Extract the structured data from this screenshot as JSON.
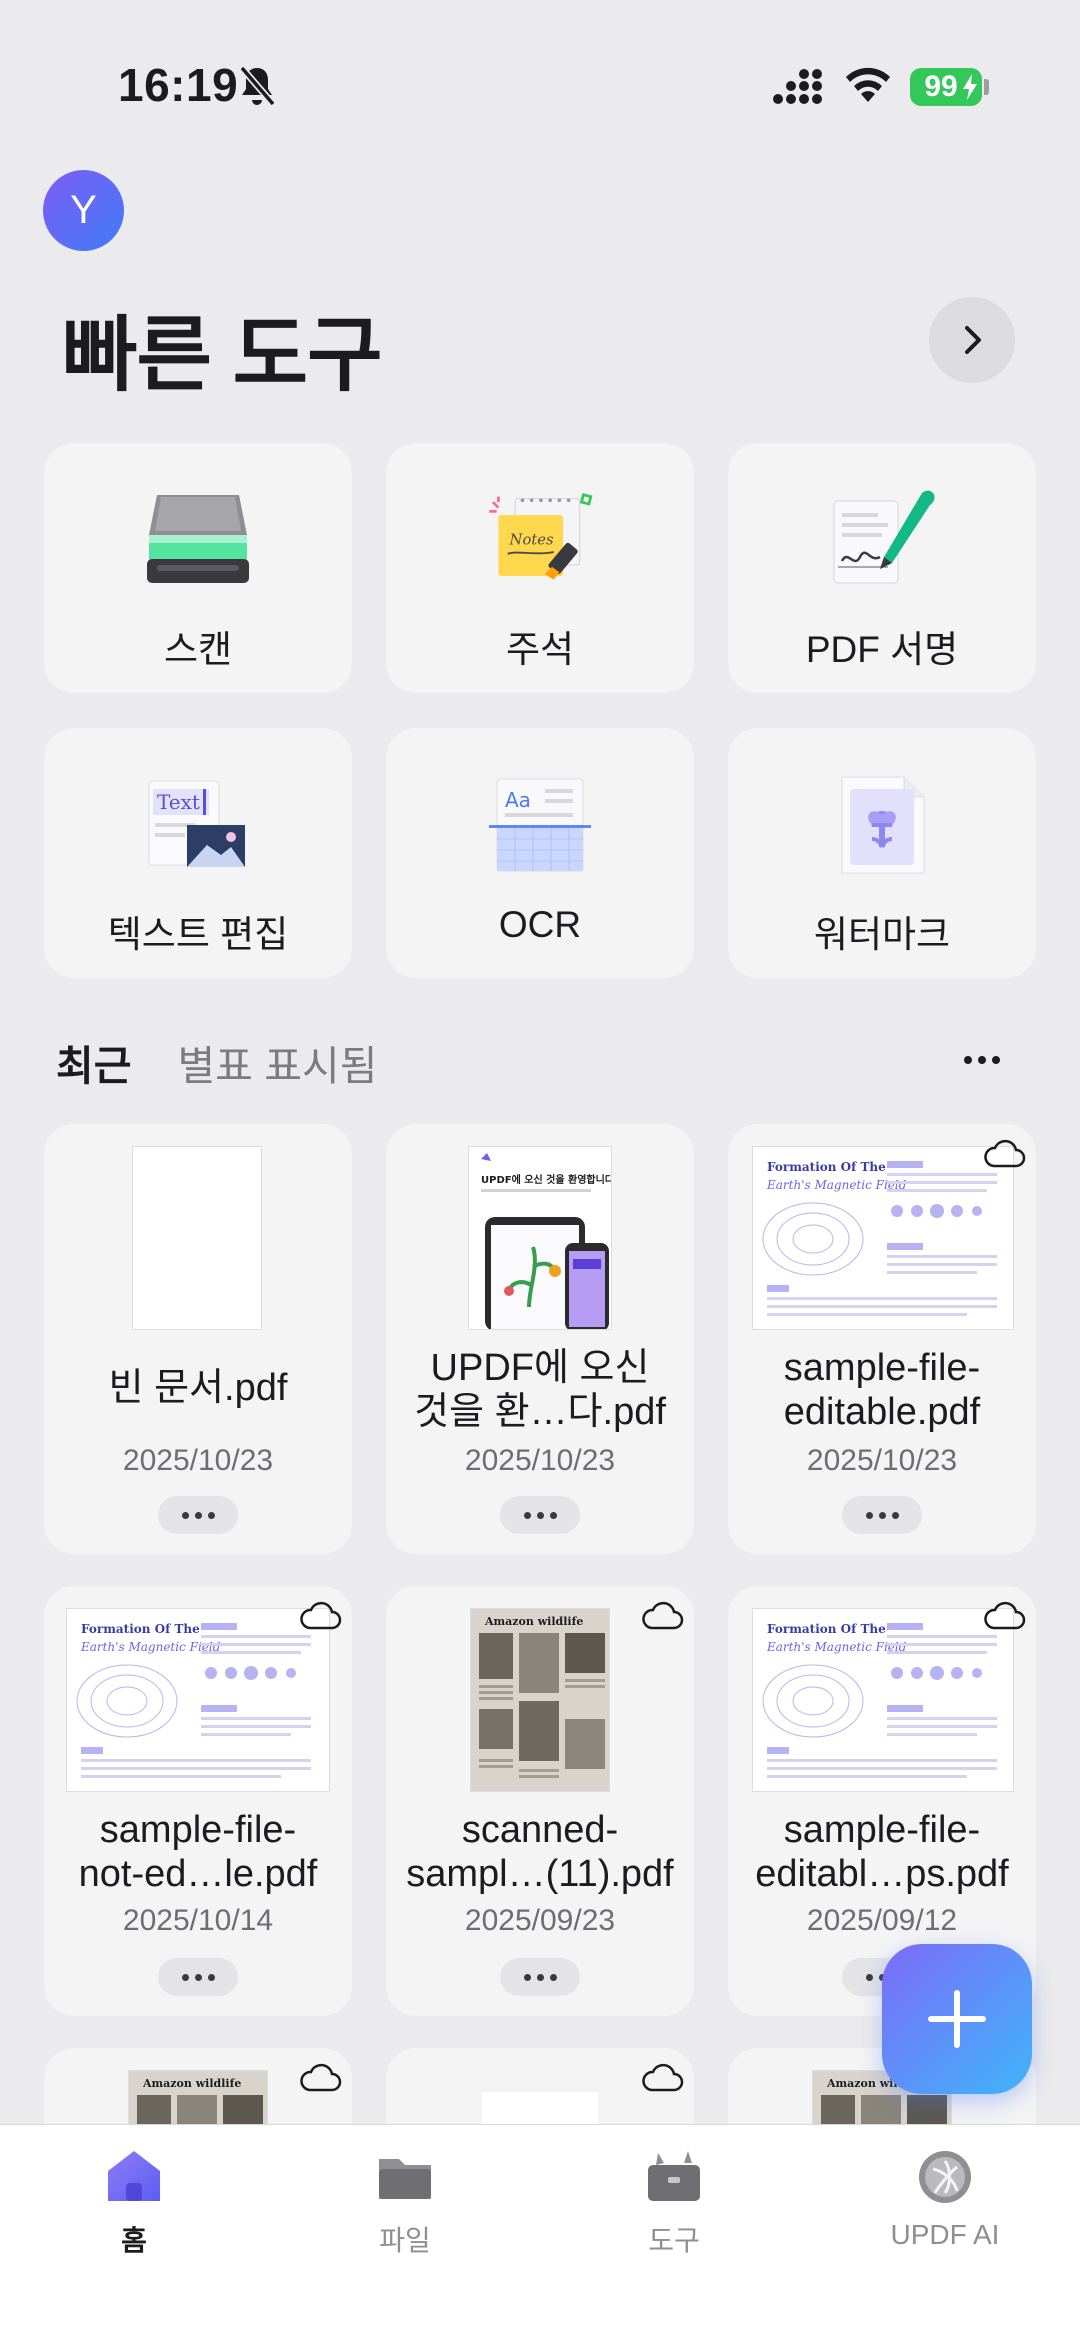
{
  "status_bar": {
    "time": "16:19",
    "battery": "99"
  },
  "profile": {
    "avatar_letter": "Y"
  },
  "quick_tools": {
    "title": "빠른 도구",
    "items": [
      {
        "label": "스캔",
        "icon": "scanner-icon"
      },
      {
        "label": "주석",
        "icon": "notes-highlighter-icon"
      },
      {
        "label": "PDF 서명",
        "icon": "signature-pen-icon"
      },
      {
        "label": "텍스트 편집",
        "icon": "text-edit-icon"
      },
      {
        "label": "OCR",
        "icon": "ocr-icon"
      },
      {
        "label": "워터마크",
        "icon": "watermark-icon"
      }
    ]
  },
  "recent": {
    "tabs": [
      {
        "label": "최근",
        "active": true
      },
      {
        "label": "별표 표시됨",
        "active": false
      }
    ],
    "files": [
      {
        "name_line1": "빈 문서.pdf",
        "name_line2": "",
        "date": "2025/10/23",
        "cloud": false,
        "thumb": "blank"
      },
      {
        "name_line1": "UPDF에 오신",
        "name_line2": "것을 환…다.pdf",
        "date": "2025/10/23",
        "cloud": false,
        "thumb": "updf"
      },
      {
        "name_line1": "sample-file-",
        "name_line2": "editable.pdf",
        "date": "2025/10/23",
        "cloud": true,
        "thumb": "magnetic"
      },
      {
        "name_line1": "sample-file-",
        "name_line2": "not-ed…le.pdf",
        "date": "2025/10/14",
        "cloud": true,
        "thumb": "magnetic"
      },
      {
        "name_line1": "scanned-",
        "name_line2": "sampl…(11).pdf",
        "date": "2025/09/23",
        "cloud": true,
        "thumb": "wildlife"
      },
      {
        "name_line1": "sample-file-",
        "name_line2": "editabl…ps.pdf",
        "date": "2025/09/12",
        "cloud": true,
        "thumb": "magnetic"
      }
    ],
    "thumb_text": {
      "updf_title": "UPDF에 오신 것을 환영합니다",
      "magnetic_title": "Formation Of The",
      "magnetic_subtitle": "Earth's Magnetic Field",
      "wildlife_title": "Amazon wildlife",
      "text_chip": "Text",
      "ocr_chip": "Aa",
      "notes_chip": "Notes"
    }
  },
  "tab_bar": {
    "items": [
      {
        "label": "홈",
        "icon": "home-icon",
        "active": true
      },
      {
        "label": "파일",
        "icon": "folder-icon",
        "active": false
      },
      {
        "label": "도구",
        "icon": "toolbox-icon",
        "active": false
      },
      {
        "label": "UPDF AI",
        "icon": "ai-icon",
        "active": false
      }
    ]
  },
  "colors": {
    "accent": "#7c6cf7",
    "accent2": "#3fb5fb",
    "battery": "#34c759"
  }
}
